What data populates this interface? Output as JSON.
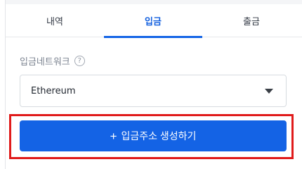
{
  "tabs": [
    {
      "label": "내역",
      "active": false
    },
    {
      "label": "입금",
      "active": true
    },
    {
      "label": "출금",
      "active": false
    }
  ],
  "network": {
    "label": "입금네트워크",
    "help_glyph": "?",
    "selected": "Ethereum",
    "icon": "chevron-down-icon"
  },
  "generate_button": {
    "icon_glyph": "+",
    "label": "입금주소 생성하기"
  },
  "colors": {
    "accent": "#1464e6",
    "button": "#1463e5",
    "highlight": "#e01b1b"
  }
}
